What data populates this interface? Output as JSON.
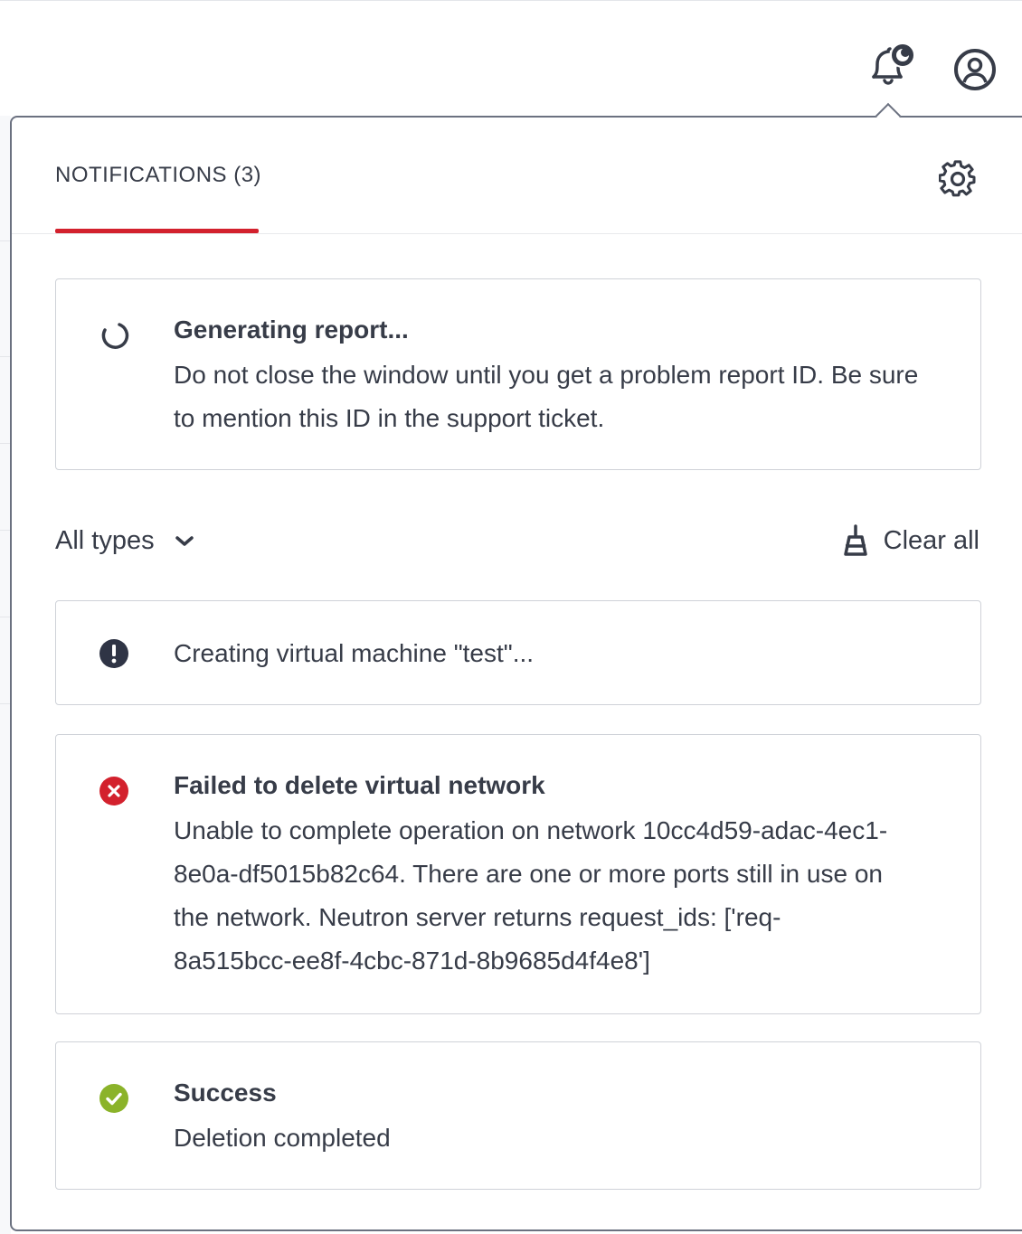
{
  "header": {
    "notifications_icon": "bell-icon",
    "user_icon": "user-icon"
  },
  "panel": {
    "title": "NOTIFICATIONS (3)",
    "settings_icon": "gear-icon",
    "accent_color": "#d3212d"
  },
  "report": {
    "icon": "spinner-icon",
    "title": "Generating report...",
    "body": "Do not close the window until you get a problem report ID. Be sure to mention this ID in the support ticket."
  },
  "filter": {
    "selected": "All types",
    "clear_all": "Clear all"
  },
  "notifications": [
    {
      "status": "info",
      "icon": "exclamation-icon",
      "color": "#2f3445",
      "title": "",
      "body": "Creating virtual machine \"test\"..."
    },
    {
      "status": "error",
      "icon": "error-icon",
      "color": "#d3212d",
      "title": "Failed to delete virtual network",
      "body": "Unable to complete operation on network 10cc4d59-adac-4ec1-8e0a-df5015b82c64. There are one or more ports still in use on the network. Neutron server returns request_ids: ['req-8a515bcc-ee8f-4cbc-871d-8b9685d4f4e8']"
    },
    {
      "status": "success",
      "icon": "check-icon",
      "color": "#8bb32a",
      "title": "Success",
      "body": "Deletion completed"
    }
  ]
}
